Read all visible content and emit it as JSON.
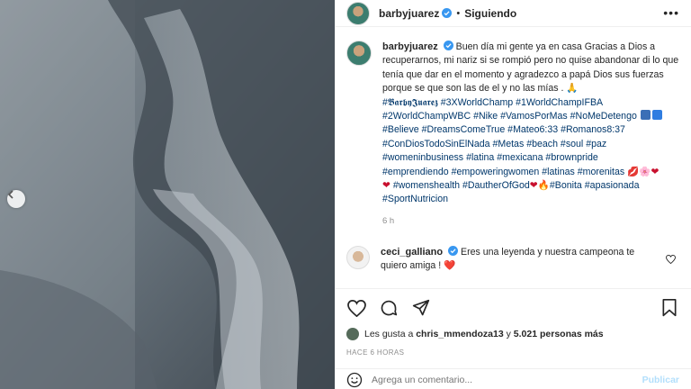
{
  "header": {
    "username": "barbyjuarez",
    "dot": "•",
    "follow_label": "Siguiendo",
    "more_icon": "more-horizontal-icon"
  },
  "caption": {
    "username": "barbyjuarez",
    "text_1": "Buen día mi gente ya en casa Gracias a Dios a recuperarnos, mi nariz si se rompió pero no quise abandonar di lo que tenía que dar en el momento y agradezco a papá Dios sus fuerzas porque se que son las de el y no las mías . 🙏",
    "line_2_tags": [
      "#𝕭𝖆𝖗𝖇𝖞𝕵𝖚𝖆𝖗𝖊𝖟",
      "#3XWorldChamp",
      "#1WorldChampIFBA"
    ],
    "line_3_tags": [
      "#2WorldChampWBC",
      "#Nike",
      "#VamosPorMas",
      "#NoMeDetengo"
    ],
    "line_4_tags": [
      "#Believe",
      "#DreamsComeTrue",
      "#Mateo6:33",
      "#Romanos8:37"
    ],
    "line_5_tags": [
      "#ConDiosTodoSinElNada",
      "#Metas",
      "#beach",
      "#soul",
      "#paz"
    ],
    "line_6_tags": [
      "#womeninbusiness",
      "#latina",
      "#mexicana",
      "#brownpride"
    ],
    "line_7_tags": [
      "#emprendiendo",
      "#empoweringwomen",
      "#latinas",
      "#morenitas"
    ],
    "line_8_tags": [
      "#womenshealth",
      "#DautherOfGod"
    ],
    "line_8b_tags": [
      "#Bonita",
      "#apasionada"
    ],
    "line_9_tags": [
      "#SportNutricion"
    ],
    "time": "6 h"
  },
  "comment": {
    "username": "ceci_galliano",
    "text": "Eres una leyenda y nuestra campeona te quiero amiga ! ❤️"
  },
  "likes": {
    "prefix": "Les gusta a",
    "user": "chris_mmendoza13",
    "middle": "y",
    "count": "5.021 personas más"
  },
  "posted": "HACE 6 HORAS",
  "add_comment": {
    "placeholder": "Agrega un comentario...",
    "publish_label": "Publicar"
  },
  "colors": {
    "link": "#00376b",
    "verified": "#3897f0",
    "publish": "#b2dffc"
  }
}
